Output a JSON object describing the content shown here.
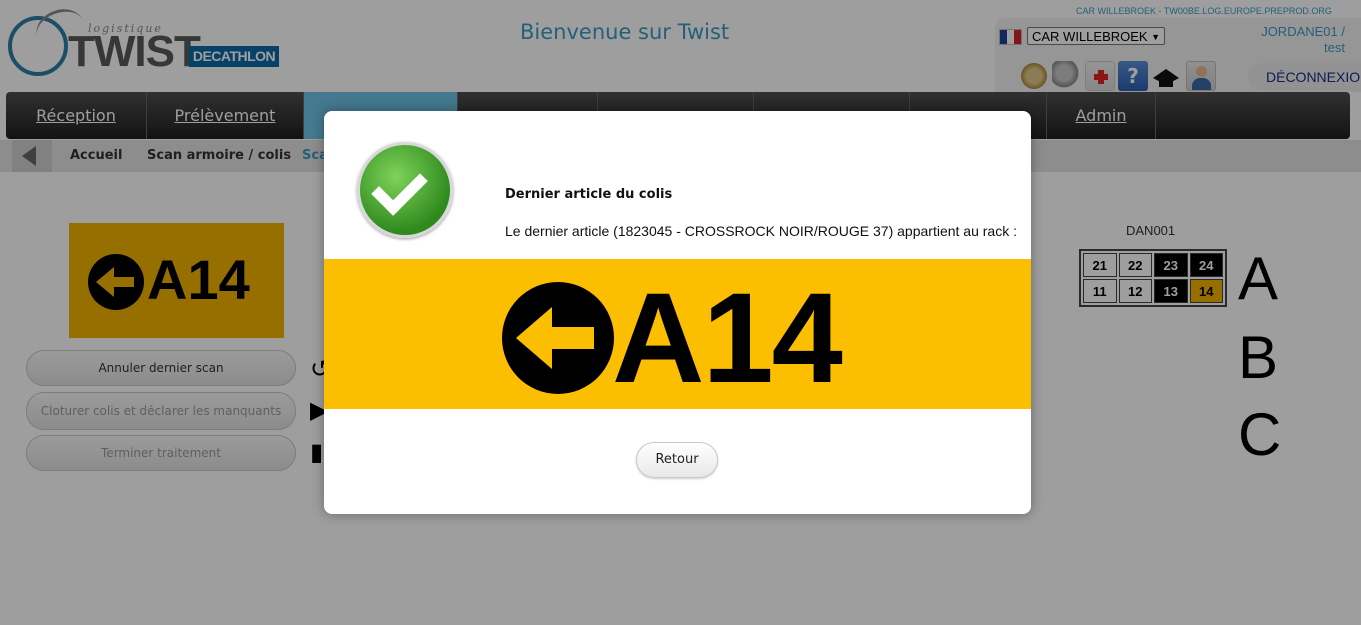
{
  "header": {
    "brand_small": "logistique",
    "brand": "TWIST",
    "partner_badge": "DECATHLON",
    "welcome": "Bienvenue sur Twist",
    "server": "CAR WILLEBROEK - TW00BE.LOG.EUROPE.PREPROD.ORG",
    "site_select": "CAR WILLEBROEK",
    "username": "JORDANE01 /",
    "role": "test",
    "logout": "DÉCONNEXION"
  },
  "nav": {
    "items": [
      "Réception",
      "Prélèvement",
      "",
      "",
      "",
      "",
      "",
      "Admin"
    ],
    "active_index": 2
  },
  "breadcrumb": {
    "items": [
      "Accueil",
      "Scan armoire / colis",
      "Sca"
    ]
  },
  "left_panel": {
    "location": "A14",
    "buttons": [
      "Annuler dernier scan",
      "Cloturer colis et déclarer les manquants",
      "Terminer traitement"
    ]
  },
  "rack": {
    "label": "DAN001",
    "rows": [
      [
        {
          "v": "21",
          "state": "light"
        },
        {
          "v": "22",
          "state": "light"
        },
        {
          "v": "23",
          "state": "dark"
        },
        {
          "v": "24",
          "state": "dark"
        }
      ],
      [
        {
          "v": "11",
          "state": "light"
        },
        {
          "v": "12",
          "state": "light"
        },
        {
          "v": "13",
          "state": "dark"
        },
        {
          "v": "14",
          "state": "target"
        }
      ]
    ],
    "letters": [
      "A",
      "B",
      "C"
    ]
  },
  "modal": {
    "title": "Dernier article du colis",
    "message": "Le dernier article (1823045 - CROSSROCK NOIR/ROUGE 37) appartient au rack :",
    "location": "A14",
    "banner_color": "#fbbe00",
    "button": "Retour"
  },
  "colors": {
    "accent": "#3a9bc4",
    "nav_active": "#6fc3e8",
    "location_yellow": "#f2b400"
  }
}
